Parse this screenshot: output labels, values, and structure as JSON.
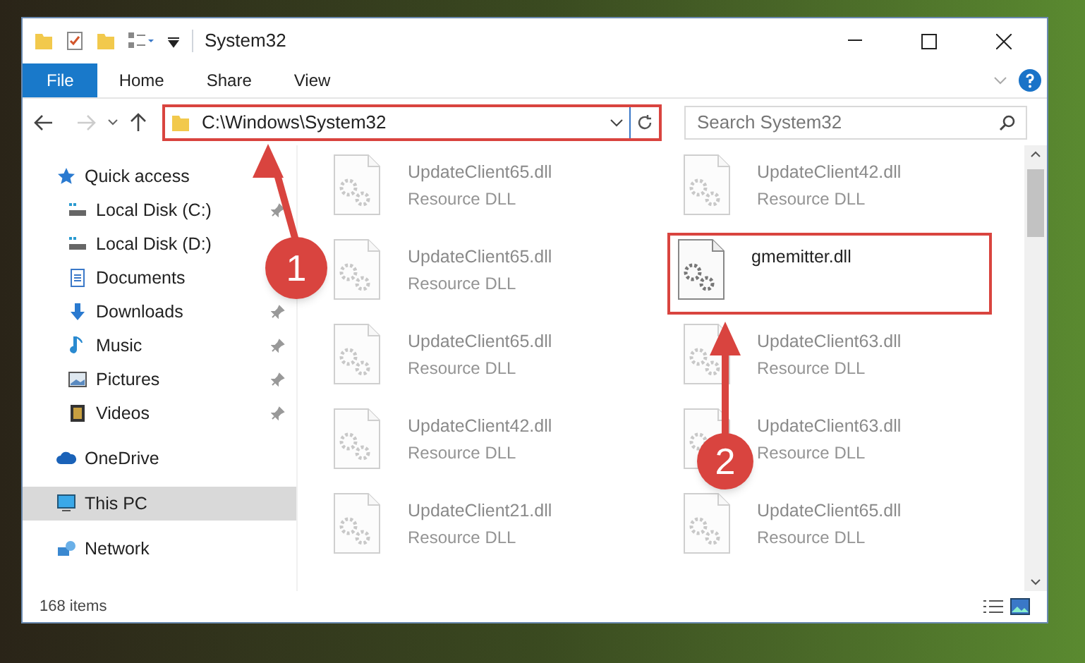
{
  "window": {
    "title": "System32"
  },
  "ribbon_tabs": [
    {
      "label": "File",
      "selected": true
    },
    {
      "label": "Home",
      "selected": false
    },
    {
      "label": "Share",
      "selected": false
    },
    {
      "label": "View",
      "selected": false
    }
  ],
  "address": {
    "value": "C:\\Windows\\System32"
  },
  "search": {
    "placeholder": "Search System32"
  },
  "sidebar": {
    "items": [
      {
        "label": "Quick access",
        "kind": "star",
        "selected": false,
        "children": [
          {
            "label": "Local Disk (C:)",
            "kind": "drive",
            "pinned": true,
            "selected": false
          },
          {
            "label": "Local Disk (D:)",
            "kind": "drive",
            "pinned": false,
            "selected": false
          },
          {
            "label": "Documents",
            "kind": "document",
            "pinned": false,
            "selected": false
          },
          {
            "label": "Downloads",
            "kind": "download",
            "pinned": true,
            "selected": false
          },
          {
            "label": "Music",
            "kind": "music",
            "pinned": true,
            "selected": false
          },
          {
            "label": "Pictures",
            "kind": "picture",
            "pinned": true,
            "selected": false
          },
          {
            "label": "Videos",
            "kind": "video",
            "pinned": true,
            "selected": false
          }
        ]
      },
      {
        "label": "OneDrive",
        "kind": "cloud",
        "selected": false
      },
      {
        "label": "This PC",
        "kind": "monitor",
        "selected": true
      },
      {
        "label": "Network",
        "kind": "network",
        "selected": false
      }
    ]
  },
  "files": [
    {
      "name": "UpdateClient65.dll",
      "type": "Resource DLL",
      "faded": true
    },
    {
      "name": "UpdateClient42.dll",
      "type": "Resource DLL",
      "faded": true
    },
    {
      "name": "UpdateClient65.dll",
      "type": "Resource DLL",
      "faded": true
    },
    {
      "name": "gmemitter.dll",
      "faded": false
    },
    {
      "name": "UpdateClient65.dll",
      "type": "Resource DLL",
      "faded": true
    },
    {
      "name": "UpdateClient63.dll",
      "type": "Resource DLL",
      "faded": true
    },
    {
      "name": "UpdateClient42.dll",
      "type": "Resource DLL",
      "faded": true
    },
    {
      "name": "UpdateClient63.dll",
      "type": "Resource DLL",
      "faded": true
    },
    {
      "name": "UpdateClient21.dll",
      "type": "Resource DLL",
      "faded": true
    },
    {
      "name": "UpdateClient65.dll",
      "type": "Resource DLL",
      "faded": true
    }
  ],
  "status_bar": {
    "item_count": "168 items"
  },
  "annotations": [
    {
      "label": "1"
    },
    {
      "label": "2"
    }
  ]
}
